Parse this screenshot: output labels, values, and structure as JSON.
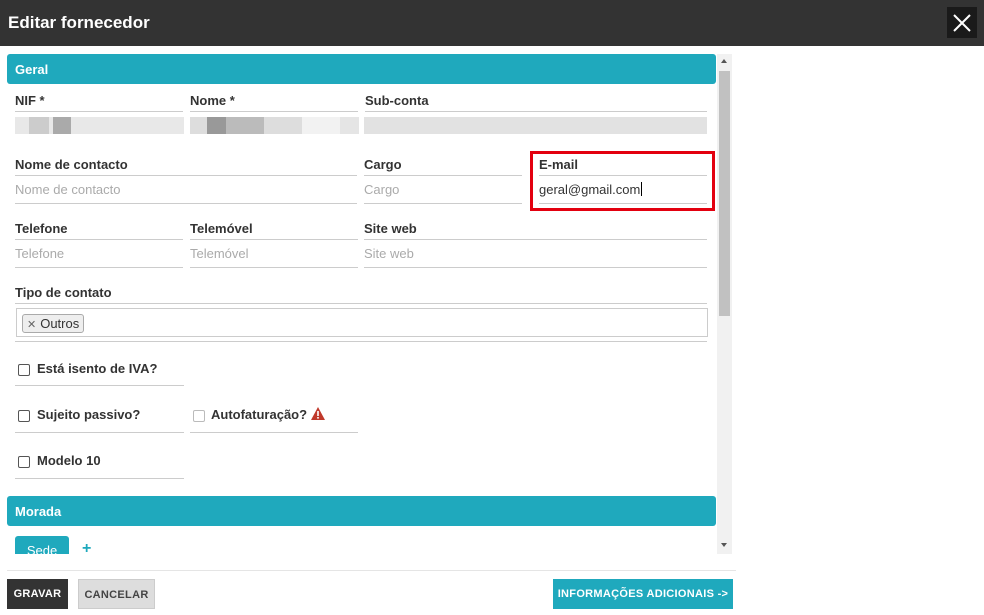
{
  "window": {
    "title": "Editar fornecedor",
    "close_icon": "close-icon"
  },
  "sections": {
    "geral": "Geral",
    "morada": "Morada"
  },
  "fields": {
    "nif": {
      "label": "NIF *"
    },
    "nome": {
      "label": "Nome *"
    },
    "subconta": {
      "label": "Sub-conta"
    },
    "nome_contacto": {
      "label": "Nome de contacto",
      "placeholder": "Nome de contacto"
    },
    "cargo": {
      "label": "Cargo",
      "placeholder": "Cargo"
    },
    "email": {
      "label": "E-mail",
      "value": "geral@gmail.com"
    },
    "telefone": {
      "label": "Telefone",
      "placeholder": "Telefone"
    },
    "telemovel": {
      "label": "Telemóvel",
      "placeholder": "Telemóvel"
    },
    "site": {
      "label": "Site web",
      "placeholder": "Site web"
    },
    "tipo_contato": {
      "label": "Tipo de contato",
      "tags": [
        "Outros"
      ]
    }
  },
  "checkboxes": {
    "isento_iva": "Está isento de IVA?",
    "sujeito_passivo": "Sujeito passivo?",
    "autofaturacao": "Autofaturação?",
    "modelo10": "Modelo 10"
  },
  "morada": {
    "tab": "Sede",
    "add": "+"
  },
  "footer": {
    "save": "GRAVAR",
    "cancel": "CANCELAR",
    "info": "INFORMAÇÕES ADICIONAIS ->"
  },
  "colors": {
    "accent": "#1fa9bd",
    "titlebar": "#333333",
    "highlight": "#e3000f",
    "warning": "#c0392b"
  }
}
